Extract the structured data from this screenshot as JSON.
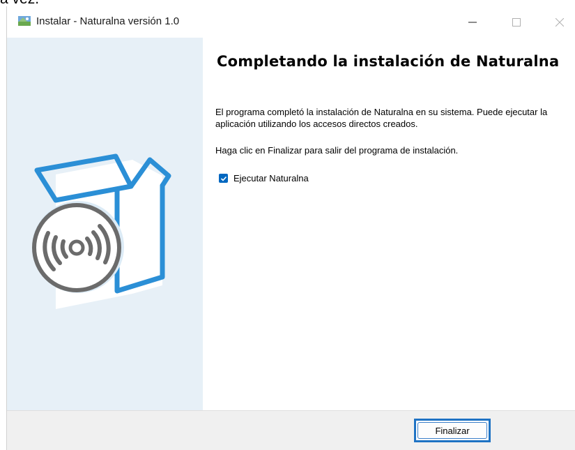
{
  "top_clip_text": "a vez.",
  "window": {
    "title": "Instalar - Naturalna versión 1.0",
    "controls": [
      "minimize",
      "maximize",
      "close"
    ]
  },
  "content": {
    "heading": "Completando la instalación de Naturalna",
    "paragraph1": "El programa completó la instalación de Naturalna en su sistema. Puede ejecutar la aplicación utilizando los accesos directos creados.",
    "paragraph2": "Haga clic en Finalizar para salir del programa de instalación.",
    "checkbox": {
      "label": "Ejecutar Naturalna",
      "checked": true
    }
  },
  "footer": {
    "finish_label": "Finalizar"
  },
  "colors": {
    "sidebar_bg": "#e7f0f7",
    "accent_blue": "#0067c0",
    "box_blue": "#2b8fd6",
    "disc_gray": "#6b6b6b",
    "footer_bg": "#f0f0f0"
  },
  "icons": [
    "installer-app-icon",
    "minimize-icon",
    "maximize-icon",
    "close-icon",
    "software-box-illustration",
    "checkmark-icon"
  ]
}
